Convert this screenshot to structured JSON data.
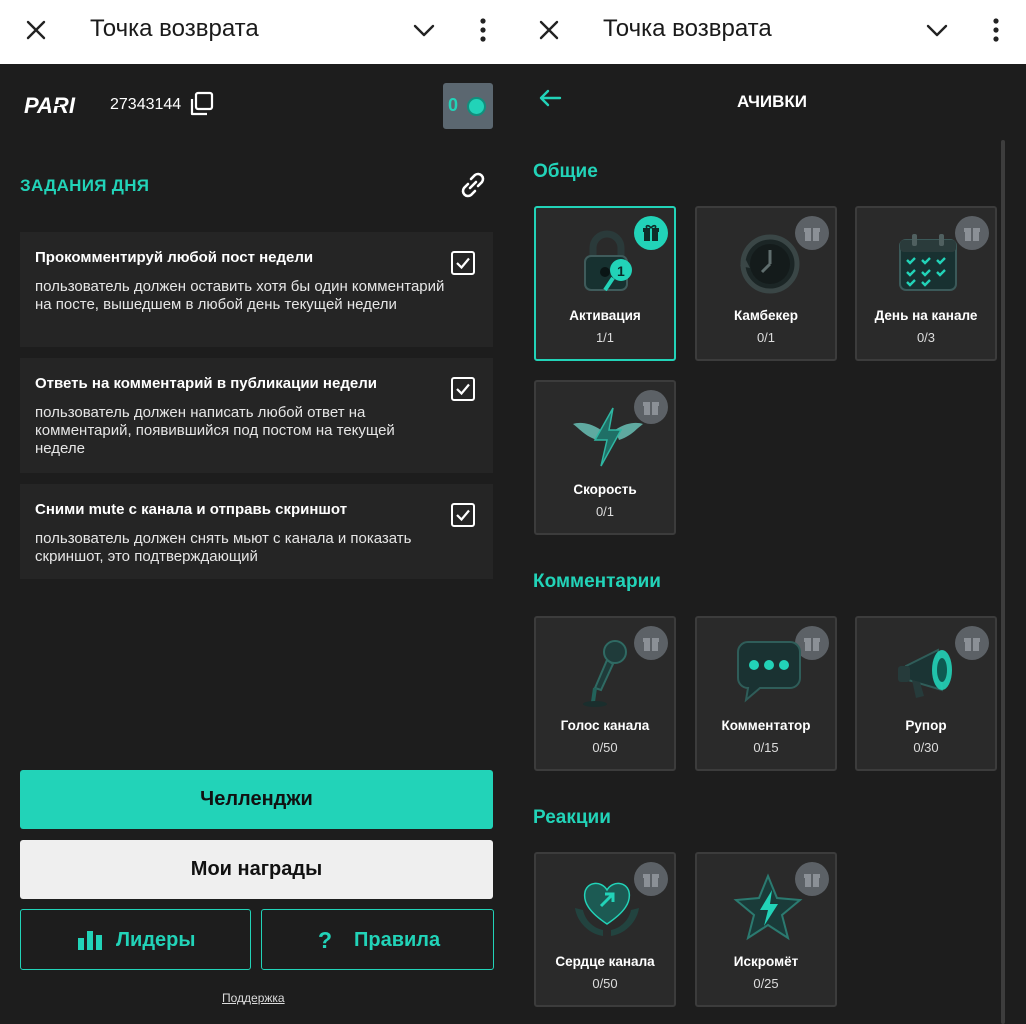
{
  "left": {
    "topbar": {
      "title": "Точка возврата"
    },
    "header": {
      "user_id": "27343144",
      "toggle_value": "0"
    },
    "tasks_title": "ЗАДАНИЯ ДНЯ",
    "tasks": [
      {
        "title": "Прокомментируй любой пост недели",
        "description": "пользователь должен оставить хотя бы один комментарий на посте, вышедшем в любой день текущей недели"
      },
      {
        "title": "Ответь на комментарий в публикации недели",
        "description": "пользователь должен написать любой ответ на комментарий, появившийся под постом на текущей неделе"
      },
      {
        "title": "Сними mute с канала и отправь скриншот",
        "description": "пользователь должен снять мьют с канала и показать скриншот, это подтверждающий"
      }
    ],
    "buttons": {
      "challenges": "Челленджи",
      "my_rewards": "Мои награды",
      "leaders": "Лидеры",
      "rules": "Правила"
    },
    "support": "Поддержка"
  },
  "right": {
    "topbar": {
      "title": "Точка возврата"
    },
    "title": "АЧИВКИ",
    "sections": [
      {
        "title": "Общие",
        "items": [
          {
            "name": "Активация",
            "progress": "1/1",
            "icon": "lock-icon",
            "unlocked": true
          },
          {
            "name": "Камбекер",
            "progress": "0/1",
            "icon": "clock-icon",
            "unlocked": false
          },
          {
            "name": "День на канале",
            "progress": "0/3",
            "icon": "calendar-icon",
            "unlocked": false
          },
          {
            "name": "Скорость",
            "progress": "0/1",
            "icon": "winged-bolt-icon",
            "unlocked": false
          }
        ]
      },
      {
        "title": "Комментарии",
        "items": [
          {
            "name": "Голос канала",
            "progress": "0/50",
            "icon": "microphone-icon",
            "unlocked": false
          },
          {
            "name": "Комментатор",
            "progress": "0/15",
            "icon": "chat-bubble-icon",
            "unlocked": false
          },
          {
            "name": "Рупор",
            "progress": "0/30",
            "icon": "megaphone-icon",
            "unlocked": false
          }
        ]
      },
      {
        "title": "Реакции",
        "items": [
          {
            "name": "Сердце канала",
            "progress": "0/50",
            "icon": "heart-hands-icon",
            "unlocked": false
          },
          {
            "name": "Искромёт",
            "progress": "0/25",
            "icon": "star-bolt-icon",
            "unlocked": false
          }
        ]
      }
    ]
  },
  "colors": {
    "accent": "#22d3b8",
    "background": "#1d1d1d",
    "card": "#2a2a2a"
  }
}
